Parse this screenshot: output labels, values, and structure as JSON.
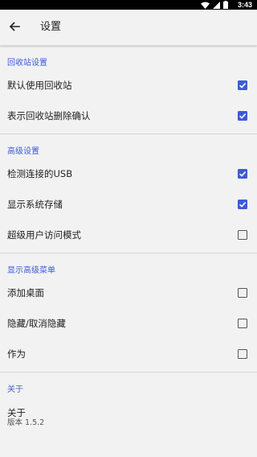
{
  "status": {
    "time": "3:43"
  },
  "appbar": {
    "title": "设置"
  },
  "sections": [
    {
      "header": "回收站设置",
      "items": [
        {
          "label": "默认使用回收站",
          "checked": true
        },
        {
          "label": "表示回收站删除确认",
          "checked": true
        }
      ]
    },
    {
      "header": "高级设置",
      "items": [
        {
          "label": "检测连接的USB",
          "checked": true
        },
        {
          "label": "显示系统存储",
          "checked": true
        },
        {
          "label": "超级用户访问模式",
          "checked": false
        }
      ]
    },
    {
      "header": "显示高级菜单",
      "items": [
        {
          "label": "添加桌面",
          "checked": false
        },
        {
          "label": "隐藏/取消隐藏",
          "checked": false
        },
        {
          "label": "作为",
          "checked": false
        }
      ]
    }
  ],
  "about": {
    "header": "关于",
    "title": "关于",
    "version": "版本 1.5.2"
  },
  "colors": {
    "accent": "#3d5bd6"
  }
}
